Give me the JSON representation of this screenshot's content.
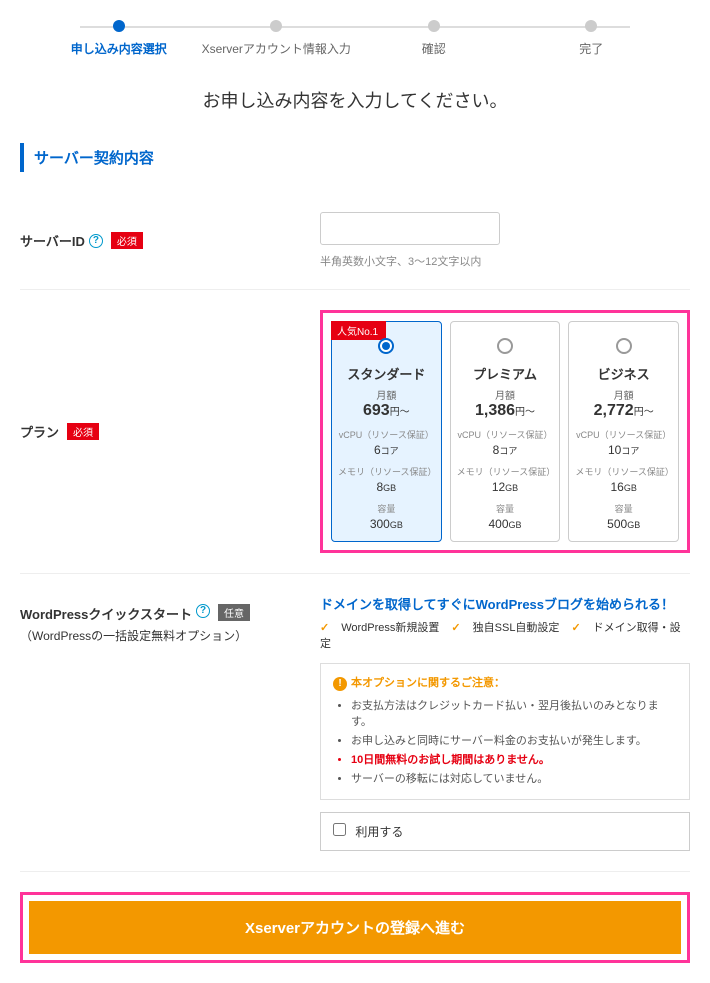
{
  "steps": [
    {
      "label": "申し込み内容選択",
      "active": true
    },
    {
      "label": "Xserverアカウント情報入力",
      "active": false
    },
    {
      "label": "確認",
      "active": false
    },
    {
      "label": "完了",
      "active": false
    }
  ],
  "page_title": "お申し込み内容を入力してください。",
  "section_heading": "サーバー契約内容",
  "labels": {
    "required": "必須",
    "optional": "任意"
  },
  "server_id": {
    "label": "サーバーID",
    "value": "",
    "hint": "半角英数小文字、3〜12文字以内"
  },
  "plan": {
    "label": "プラン",
    "popular_badge": "人気No.1",
    "spec_labels": {
      "price_prefix": "月額",
      "price_suffix": "円〜",
      "vcpu": "vCPU（リソース保証）",
      "memory": "メモリ（リソース保証）",
      "storage": "容量",
      "core_unit": "コア",
      "gb_unit": "GB"
    },
    "options": [
      {
        "name": "スタンダード",
        "price": "693",
        "vcpu": "6",
        "memory": "8",
        "storage": "300",
        "selected": true,
        "popular": true
      },
      {
        "name": "プレミアム",
        "price": "1,386",
        "vcpu": "8",
        "memory": "12",
        "storage": "400",
        "selected": false,
        "popular": false
      },
      {
        "name": "ビジネス",
        "price": "2,772",
        "vcpu": "10",
        "memory": "16",
        "storage": "500",
        "selected": false,
        "popular": false
      }
    ]
  },
  "quickstart": {
    "label": "WordPressクイックスタート",
    "sublabel": "（WordPressの一括設定無料オプション）",
    "headline": "ドメインを取得してすぐにWordPressブログを始められる！",
    "features": [
      "WordPress新規設置",
      "独自SSL自動設定",
      "ドメイン取得・設定"
    ],
    "notice_title": "本オプションに関するご注意：",
    "notice_items": [
      {
        "text": "お支払方法はクレジットカード払い・翌月後払いのみとなります。",
        "red": false
      },
      {
        "text": "お申し込みと同時にサーバー料金のお支払いが発生します。",
        "red": false
      },
      {
        "text": "10日間無料のお試し期間はありません。",
        "red": true
      },
      {
        "text": "サーバーの移転には対応していません。",
        "red": false
      }
    ],
    "use_label": "利用する"
  },
  "submit": {
    "label": "Xserverアカウントの登録へ進む"
  }
}
